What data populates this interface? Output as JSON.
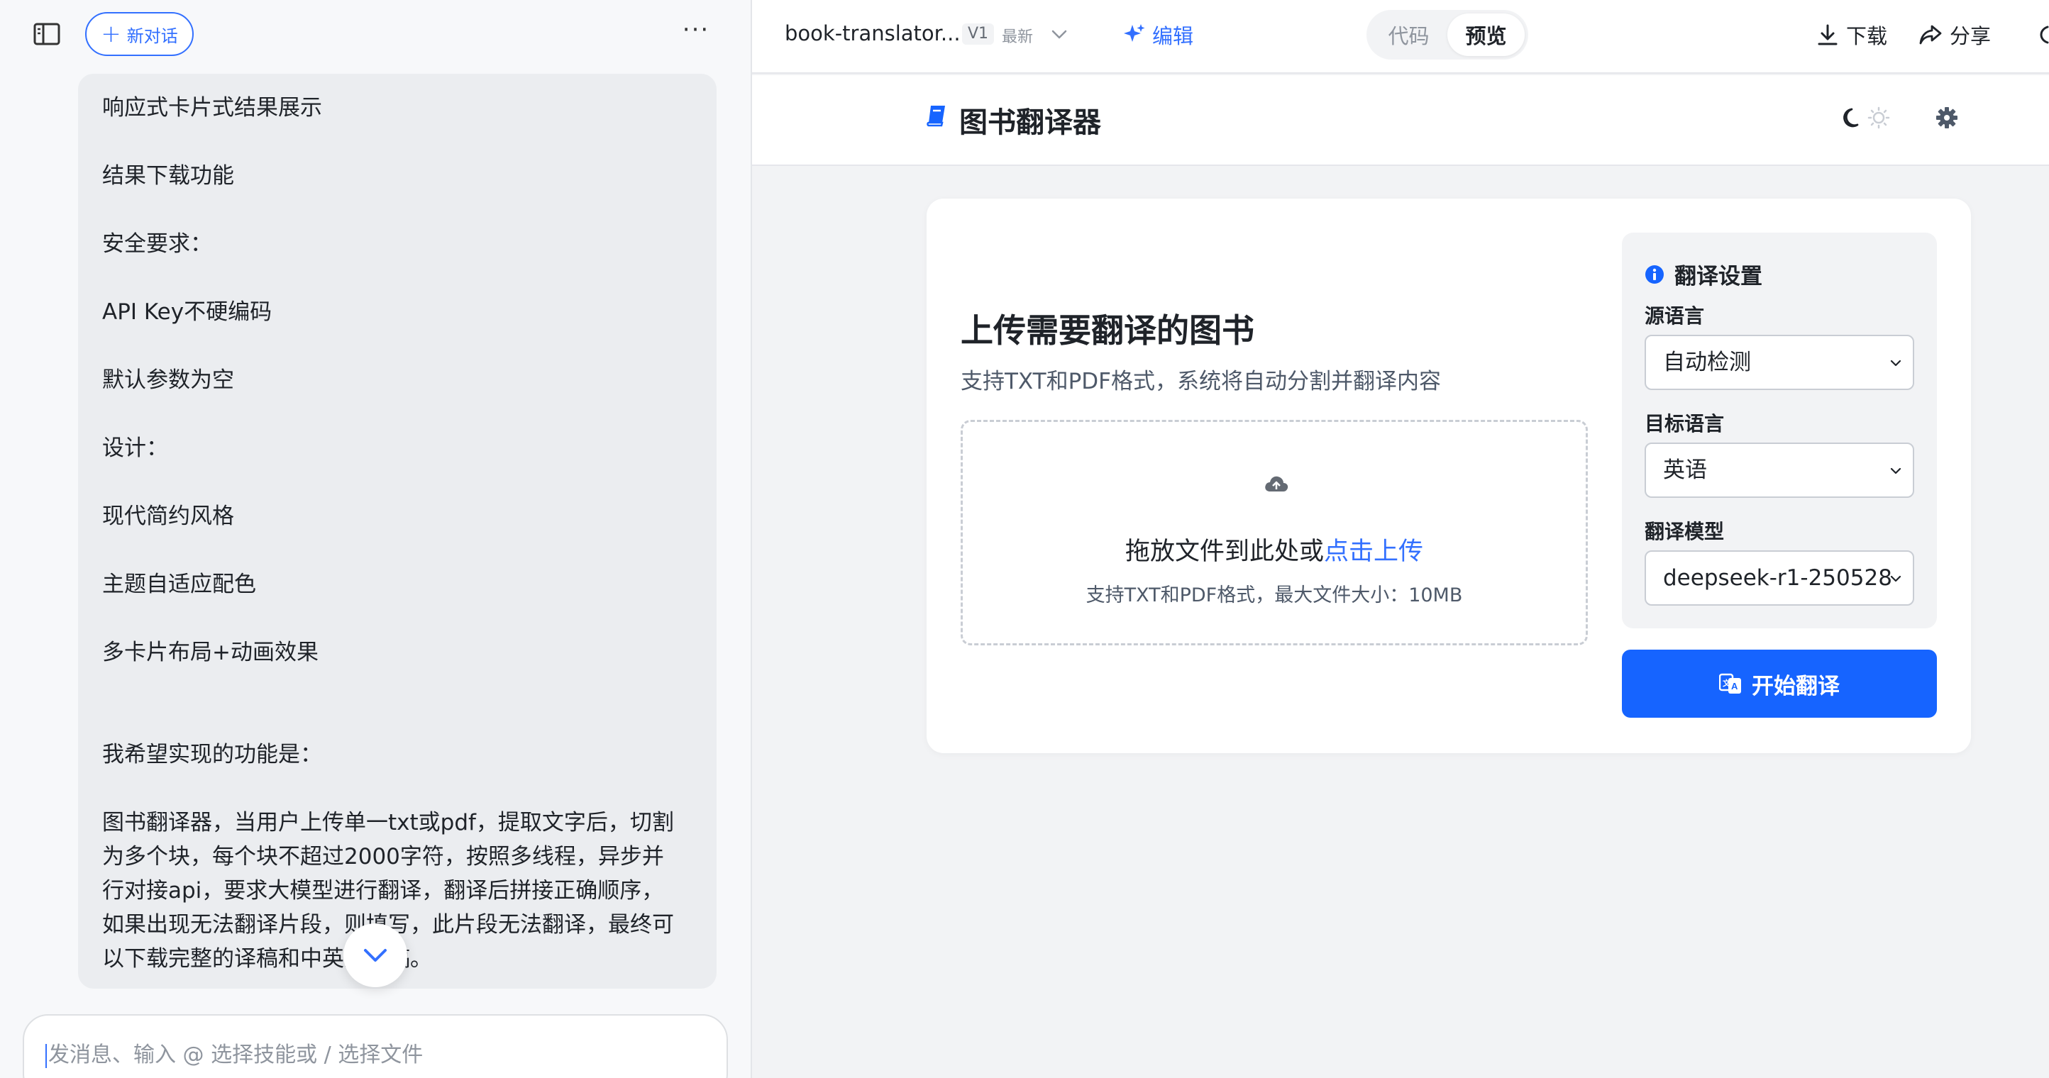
{
  "left": {
    "new_chat_label": "新对话",
    "more_label": "···",
    "messages": [
      "响应式卡片式结果展示",
      "结果下载功能",
      "安全要求：",
      "API Key不硬编码",
      "默认参数为空",
      "设计：",
      "现代简约风格",
      "主题自适应配色",
      "多卡片布局+动画效果"
    ],
    "wish": "我希望实现的功能是：",
    "description": [
      "图书翻译器，当用户上传单一txt或pdf，提取文字后，切割",
      "为多个块，每个块不超过2000字符，按照多线程，异步并",
      "行对接api，要求大模型进行翻译，翻译后拼接正确顺序，",
      "如果出现无法翻译片段，则填写，此片段无法翻译，最终可",
      "以下载完整的译稿和中英对照稿。"
    ],
    "input_placeholder": "发消息、输入 @ 选择技能或 / 选择文件"
  },
  "topbar": {
    "file_name": "book-translator...",
    "version": "V1",
    "latest": "最新",
    "edit_label": "编辑",
    "tabs": [
      {
        "label": "代码",
        "active": false
      },
      {
        "label": "预览",
        "active": true
      }
    ],
    "download_label": "下载",
    "share_label": "分享"
  },
  "app": {
    "title": "图书翻译器",
    "upload_title": "上传需要翻译的图书",
    "upload_subtitle": "支持TXT和PDF格式，系统将自动分割并翻译内容",
    "dropzone_text": "拖放文件到此处或",
    "dropzone_link": "点击上传",
    "dropzone_hint": "支持TXT和PDF格式，最大文件大小：10MB",
    "settings": {
      "title": "翻译设置",
      "source_label": "源语言",
      "source_value": "自动检测",
      "target_label": "目标语言",
      "target_value": "英语",
      "model_label": "翻译模型",
      "model_value": "deepseek-r1-250528"
    },
    "start_label": "开始翻译"
  },
  "colors": {
    "accent": "#3370ff",
    "primary_button": "#1664ff",
    "bubble_bg": "#ebedf0",
    "page_bg": "#f2f3f5"
  },
  "icons": {
    "sidebar_toggle": "sidebar-toggle-icon",
    "new_chat": "plus-icon",
    "edit": "sparkle-icon",
    "download": "download-icon",
    "share": "share-icon",
    "app_logo": "book-icon",
    "theme_dark": "moon-icon",
    "theme_light": "sun-icon",
    "settings": "gear-icon",
    "upload": "cloud-upload-icon",
    "info": "info-icon",
    "translate": "translate-icon",
    "scroll_down": "chevron-down-icon"
  }
}
